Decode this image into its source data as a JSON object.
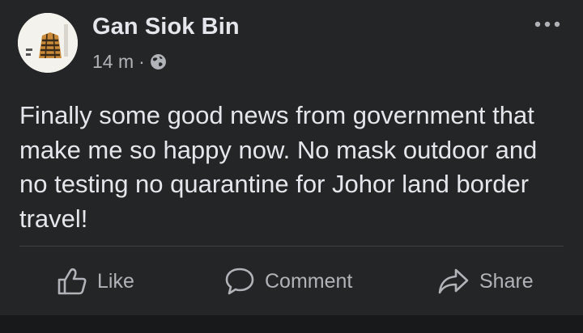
{
  "post": {
    "author": "Gan Siok Bin",
    "time": "14 m",
    "separator": "·",
    "privacy_icon": "globe-icon",
    "text": "Finally some good news from government that make me so happy now. No mask outdoor and no testing no quarantine for Johor land border travel!"
  },
  "actions": {
    "like_label": "Like",
    "comment_label": "Comment",
    "share_label": "Share"
  },
  "theme": {
    "background": "#18191a",
    "card": "#242526",
    "primary_text": "#e4e6eb",
    "secondary_text": "#b0b3b8",
    "divider": "#3e4042"
  }
}
